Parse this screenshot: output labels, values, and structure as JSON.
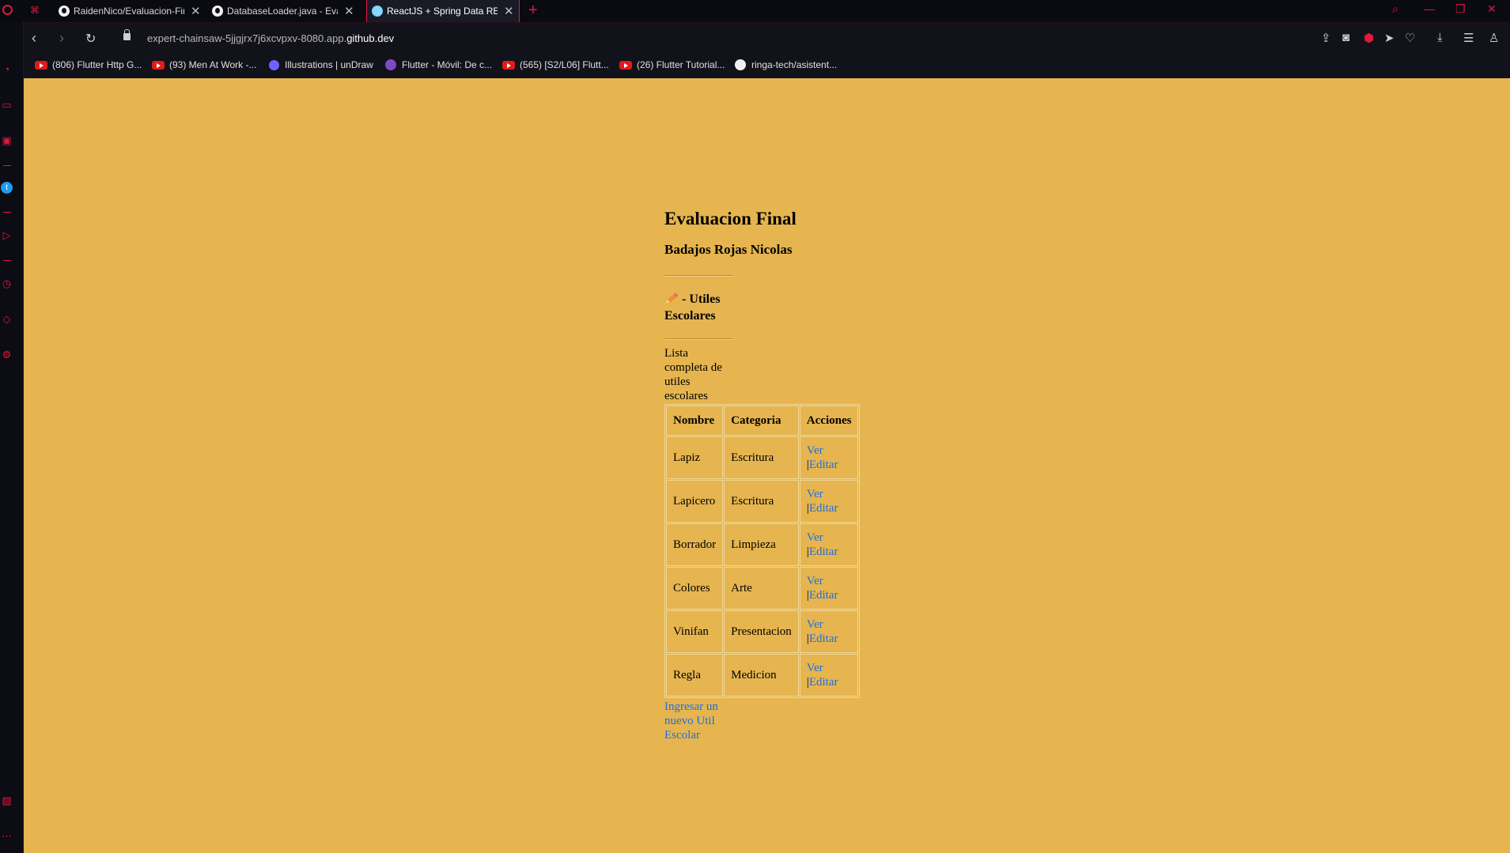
{
  "browser": {
    "tabs": [
      {
        "title": "RaidenNico/Evaluacion-Fin",
        "icon": "github-icon"
      },
      {
        "title": "DatabaseLoader.java - Eval",
        "icon": "github-icon"
      },
      {
        "title": "ReactJS + Spring Data REST",
        "icon": "react-icon"
      }
    ],
    "url_prefix": "expert-chainsaw-5jjgjrx7j6xcvpxv-8080.app.",
    "url_domain": "github.dev",
    "bookmarks": [
      {
        "label": "(806) Flutter Http G...",
        "icon": "youtube-icon"
      },
      {
        "label": "(93) Men At Work -...",
        "icon": "youtube-icon"
      },
      {
        "label": "Illustrations | unDraw",
        "icon": "undraw-icon"
      },
      {
        "label": "Flutter - Móvil: De c...",
        "icon": "flutter-course-icon"
      },
      {
        "label": "(565) [S2/L06] Flutt...",
        "icon": "youtube-icon"
      },
      {
        "label": "(26) Flutter Tutorial...",
        "icon": "youtube-icon"
      },
      {
        "label": "ringa-tech/asistent...",
        "icon": "github-icon"
      }
    ],
    "accent_color": "#e0193f"
  },
  "page": {
    "title": "Evaluacion Final",
    "author": "Badajos Rojas Nicolas",
    "section_title": "- Utiles Escolares",
    "description": "Lista completa de utiles escolares",
    "table": {
      "headers": [
        "Nombre",
        "Categoria",
        "Acciones"
      ],
      "rows": [
        {
          "nombre": "Lapiz",
          "categoria": "Escritura"
        },
        {
          "nombre": "Lapicero",
          "categoria": "Escritura"
        },
        {
          "nombre": "Borrador",
          "categoria": "Limpieza"
        },
        {
          "nombre": "Colores",
          "categoria": "Arte"
        },
        {
          "nombre": "Vinifan",
          "categoria": "Presentacion"
        },
        {
          "nombre": "Regla",
          "categoria": "Medicion"
        }
      ],
      "action_view": "Ver",
      "action_sep": "|",
      "action_edit": "Editar"
    },
    "new_link": "Ingresar un nuevo Util Escolar",
    "background_color": "#e6b54f",
    "link_color": "#1d6fe0"
  }
}
